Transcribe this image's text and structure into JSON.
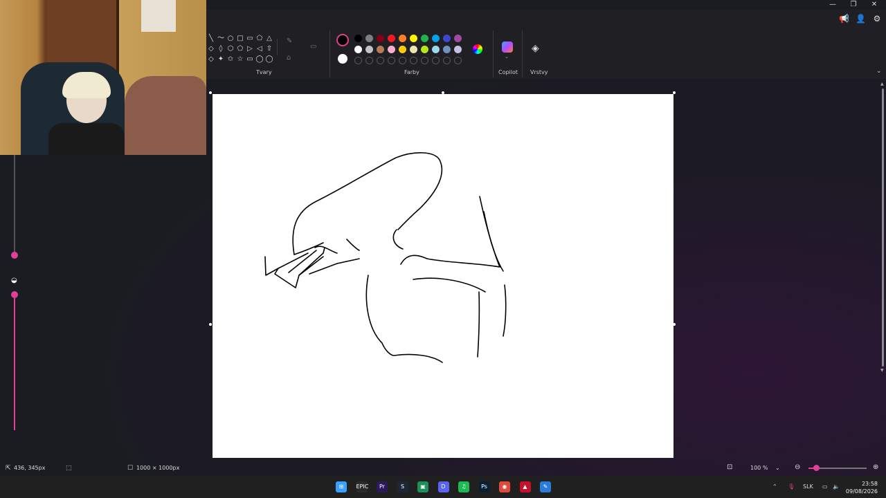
{
  "window": {
    "minimize_glyph": "—",
    "maximize_glyph": "❐",
    "close_glyph": "✕"
  },
  "ribbon": {
    "groups": {
      "shapes_label": "Tvary",
      "colors_label": "Farby",
      "copilot_label": "Copilot",
      "layers_label": "Vrstvy"
    },
    "shape_glyphs": [
      "╲",
      "〜",
      "○",
      "□",
      "▭",
      "⬠",
      "△",
      "◇",
      "◊",
      "⬡",
      "⬠",
      "▷",
      "◁",
      "⇧",
      "◇",
      "✦",
      "✩",
      "☆",
      "▭",
      "◯",
      "◯"
    ],
    "colors_row1": [
      "#000000",
      "#7f7f7f",
      "#880015",
      "#ed1c24",
      "#ff7f27",
      "#fff200",
      "#22b14c",
      "#00a2e8",
      "#3f48cc",
      "#a349a4"
    ],
    "colors_row2": [
      "#ffffff",
      "#c3c3c3",
      "#b97a57",
      "#ffaec9",
      "#ffc90e",
      "#efe4b0",
      "#b5e61d",
      "#99d9ea",
      "#7092be",
      "#c8bfe7"
    ],
    "colors_row3_empty_count": 10,
    "primary_color": "#000000",
    "secondary_color": "#ffffff",
    "accent": "#e0409a"
  },
  "top_icons": [
    "megaphone-icon",
    "account-icon",
    "gear-icon"
  ],
  "status": {
    "cursor_pos": "436, 345px",
    "canvas_size": "1000 × 1000px",
    "zoom": "100 %"
  },
  "taskbar": {
    "apps": [
      {
        "name": "start-icon",
        "label": "⊞",
        "color": "#3aa0ff"
      },
      {
        "name": "epic-games-icon",
        "label": "EPIC",
        "color": "#2a2a2a"
      },
      {
        "name": "premiere-icon",
        "label": "Pr",
        "color": "#2a1a5c"
      },
      {
        "name": "steam-icon",
        "label": "S",
        "color": "#1b2838"
      },
      {
        "name": "app-green-icon",
        "label": "▣",
        "color": "#1e8f5a"
      },
      {
        "name": "discord-icon",
        "label": "D",
        "color": "#5865f2"
      },
      {
        "name": "spotify-icon",
        "label": "♫",
        "color": "#1db954"
      },
      {
        "name": "photoshop-icon",
        "label": "Ps",
        "color": "#0a1f33"
      },
      {
        "name": "chrome-icon",
        "label": "◉",
        "color": "#dd4b39"
      },
      {
        "name": "app-red-icon",
        "label": "▲",
        "color": "#c8102e"
      },
      {
        "name": "paint-icon",
        "label": "✎",
        "color": "#2b7bd8"
      }
    ],
    "language": "SLK",
    "time": "23:58",
    "date": "09/08/2026"
  }
}
